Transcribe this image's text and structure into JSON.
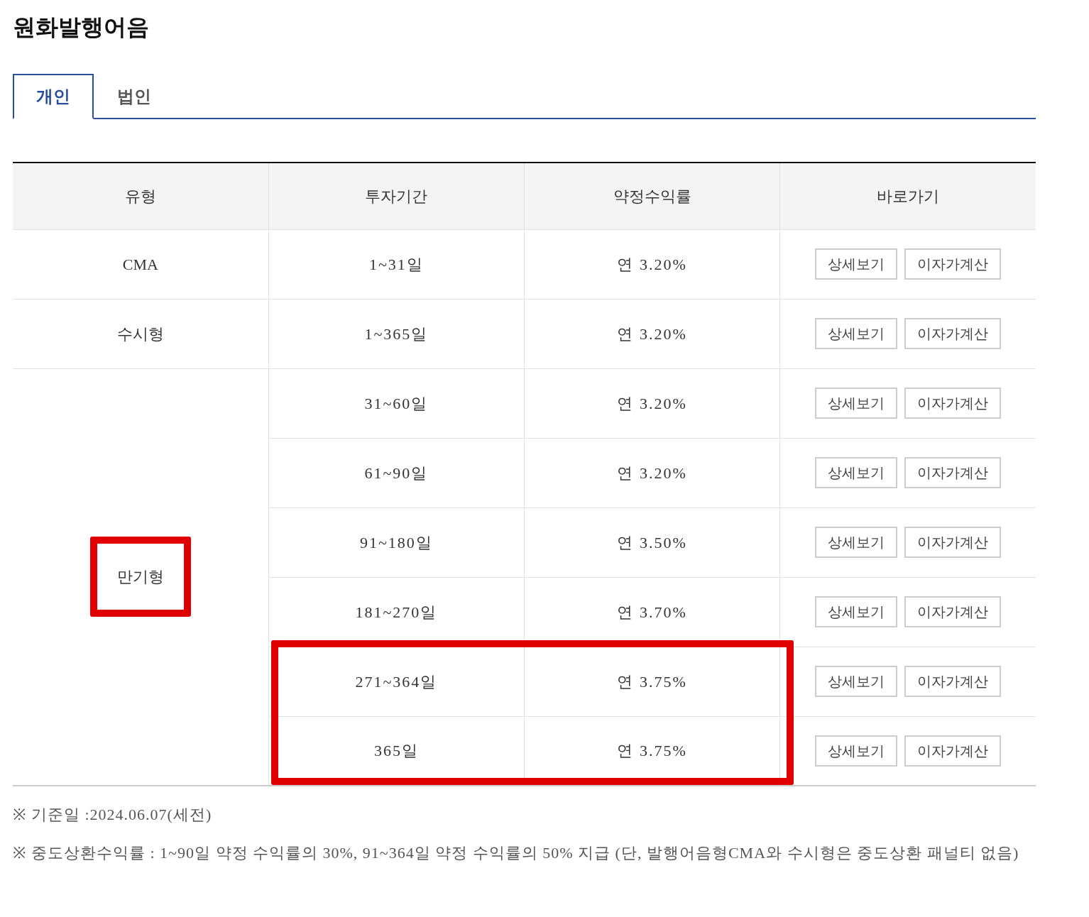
{
  "title": "원화발행어음",
  "tabs": [
    {
      "label": "개인",
      "selected": true
    },
    {
      "label": "법인",
      "selected": false
    }
  ],
  "table": {
    "columns": [
      "유형",
      "투자기간",
      "약정수익률",
      "바로가기"
    ],
    "groups": [
      {
        "type": "CMA",
        "highlighted": false,
        "rows": [
          {
            "period": "1~31일",
            "rate": "연 3.20%",
            "highlighted": false,
            "buttons": [
              "상세보기",
              "이자가계산"
            ]
          }
        ]
      },
      {
        "type": "수시형",
        "highlighted": false,
        "rows": [
          {
            "period": "1~365일",
            "rate": "연 3.20%",
            "highlighted": false,
            "buttons": [
              "상세보기",
              "이자가계산"
            ]
          }
        ]
      },
      {
        "type": "만기형",
        "highlighted": true,
        "rows": [
          {
            "period": "31~60일",
            "rate": "연 3.20%",
            "highlighted": false,
            "buttons": [
              "상세보기",
              "이자가계산"
            ]
          },
          {
            "period": "61~90일",
            "rate": "연 3.20%",
            "highlighted": false,
            "buttons": [
              "상세보기",
              "이자가계산"
            ]
          },
          {
            "period": "91~180일",
            "rate": "연 3.50%",
            "highlighted": false,
            "buttons": [
              "상세보기",
              "이자가계산"
            ]
          },
          {
            "period": "181~270일",
            "rate": "연 3.70%",
            "highlighted": false,
            "buttons": [
              "상세보기",
              "이자가계산"
            ]
          },
          {
            "period": "271~364일",
            "rate": "연 3.75%",
            "highlighted": true,
            "buttons": [
              "상세보기",
              "이자가계산"
            ]
          },
          {
            "period": "365일",
            "rate": "연 3.75%",
            "highlighted": true,
            "buttons": [
              "상세보기",
              "이자가계산"
            ]
          }
        ]
      }
    ]
  },
  "notes": [
    {
      "mark": "※",
      "text": "기준일 :2024.06.07(세전)"
    },
    {
      "mark": "※",
      "text": "중도상환수익률 : 1~90일 약정 수익률의 30%, 91~364일 약정 수익률의 50% 지급 (단, 발행어음형CMA와 수시형은 중도상환 패널티 없음)"
    }
  ]
}
